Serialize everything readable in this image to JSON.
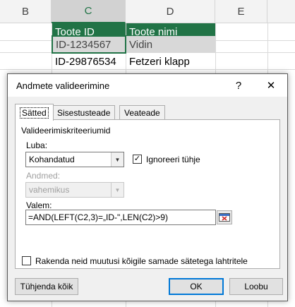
{
  "sheet": {
    "columns": [
      "B",
      "C",
      "D",
      "E"
    ],
    "selected_column": "C",
    "header_row": {
      "c": "Toote ID",
      "d": "Toote nimi"
    },
    "rows": [
      {
        "c": "ID-1234567",
        "d": "Vidin"
      },
      {
        "c": "ID-29876534",
        "d": "Fetzeri klapp"
      }
    ],
    "colors": {
      "header_fill": "#217346",
      "header_text": "#ffffff",
      "selection": "#d8d8d8"
    }
  },
  "dialog": {
    "title": "Andmete valideerimine",
    "help_label": "?",
    "close_label": "✕",
    "tabs": [
      {
        "label": "Sätted",
        "active": true
      },
      {
        "label": "Sisestusteade",
        "active": false
      },
      {
        "label": "Veateade",
        "active": false
      }
    ],
    "group_title": "Valideerimiskriteeriumid",
    "allow_label": "Luba:",
    "allow_value": "Kohandatud",
    "ignore_blank_label": "Ignoreeri tühje",
    "ignore_blank_checked": "✓",
    "data_label": "Andmed:",
    "data_value": "vahemikus",
    "formula_label": "Valem:",
    "formula_value": "=AND(LEFT(C2,3)=„ID-\",LEN(C2)>9)",
    "apply_all_label": "Rakenda neid muutusi kõigile samade sätetega lahtritele",
    "clear_all_label": "Tühjenda kõik",
    "ok_label": "OK",
    "cancel_label": "Loobu",
    "accent_color": "#0078d7"
  }
}
